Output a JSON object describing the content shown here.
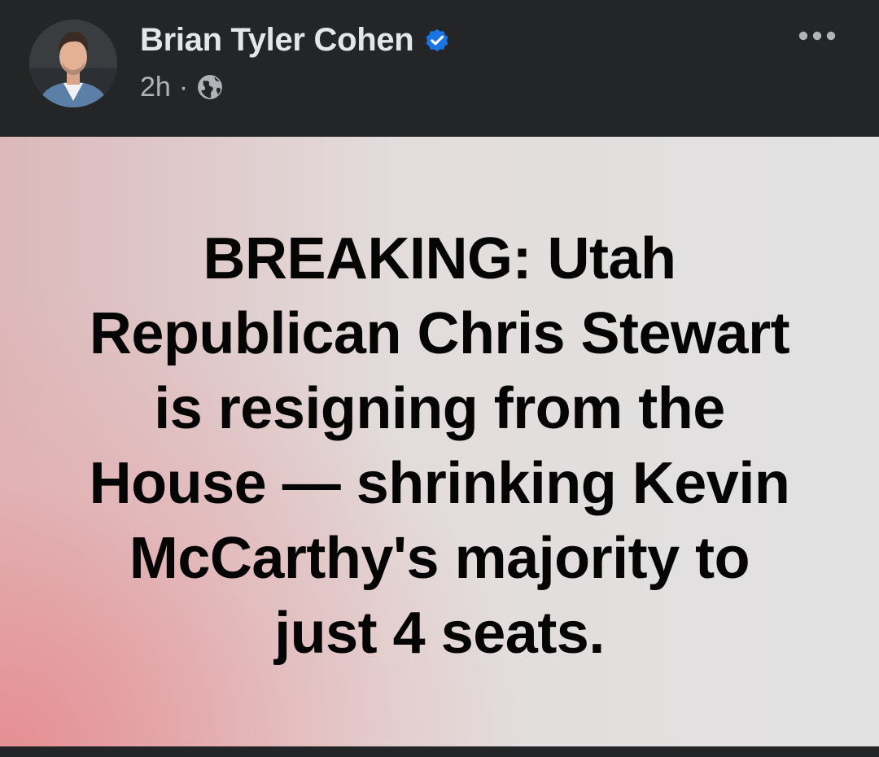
{
  "post": {
    "author": {
      "name": "Brian Tyler Cohen",
      "verified": true,
      "avatar_icon": "profile-photo"
    },
    "meta": {
      "time": "2h",
      "separator": "·",
      "audience_icon": "globe-icon"
    },
    "more_icon": "more-dots-icon",
    "status": {
      "lines": [
        "BREAKING: Utah",
        "Republican Chris Stewart",
        "is resigning from the",
        "House — shrinking Kevin",
        "McCarthy's majority to",
        "just 4 seats."
      ]
    }
  },
  "colors": {
    "header_bg": "#242526",
    "name_text": "#e4e6eb",
    "meta_text": "#b0b3b8",
    "verified_blue": "#1b74e4",
    "card_gradient_start": "#e68c91",
    "card_gradient_end": "#e2e2e2",
    "status_text": "#050505"
  }
}
